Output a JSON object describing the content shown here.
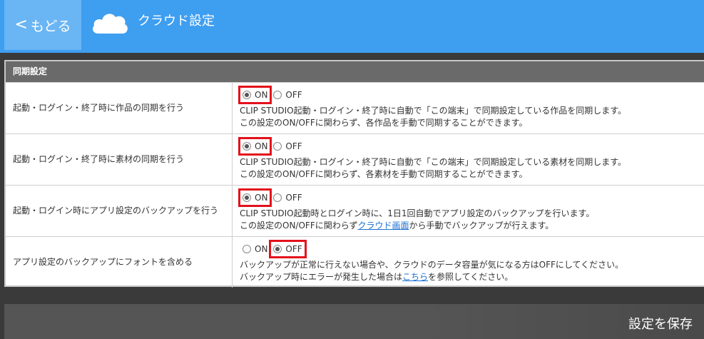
{
  "header": {
    "back_label": "もどる",
    "title": "クラウド設定",
    "icon": "cloud-icon",
    "accent_color": "#3e9ef0"
  },
  "section": {
    "title": "同期設定"
  },
  "rows": [
    {
      "label": "起動・ログイン・終了時に作品の同期を行う",
      "on_label": "ON",
      "off_label": "OFF",
      "selected": "ON",
      "desc_line1": "CLIP STUDIO起動・ログイン・終了時に自動で「この端末」で同期設定している作品を同期します。",
      "desc_line2": "この設定のON/OFFに関わらず、各作品を手動で同期することができます。"
    },
    {
      "label": "起動・ログイン・終了時に素材の同期を行う",
      "on_label": "ON",
      "off_label": "OFF",
      "selected": "ON",
      "desc_line1": "CLIP STUDIO起動・ログイン・終了時に自動で「この端末」で同期設定している素材を同期します。",
      "desc_line2": "この設定のON/OFFに関わらず、各素材を手動で同期することができます。"
    },
    {
      "label": "起動・ログイン時にアプリ設定のバックアップを行う",
      "on_label": "ON",
      "off_label": "OFF",
      "selected": "ON",
      "desc_line1": "CLIP STUDIO起動時とログイン時に、1日1回自動でアプリ設定のバックアップを行います。",
      "desc_line2_pre": "この設定のON/OFFに関わらず",
      "desc_line2_link": "クラウド画面",
      "desc_line2_post": "から手動でバックアップが行えます。"
    },
    {
      "label": "アプリ設定のバックアップにフォントを含める",
      "on_label": "ON",
      "off_label": "OFF",
      "selected": "OFF",
      "desc_line1": "バックアップが正常に行えない場合や、クラウドのデータ容量が気になる方はOFFにしてください。",
      "desc_line2_pre": "バックアップ時にエラーが発生した場合は",
      "desc_line2_link": "こちら",
      "desc_line2_post": "を参照してください。"
    }
  ],
  "footer": {
    "save_label": "設定を保存"
  }
}
